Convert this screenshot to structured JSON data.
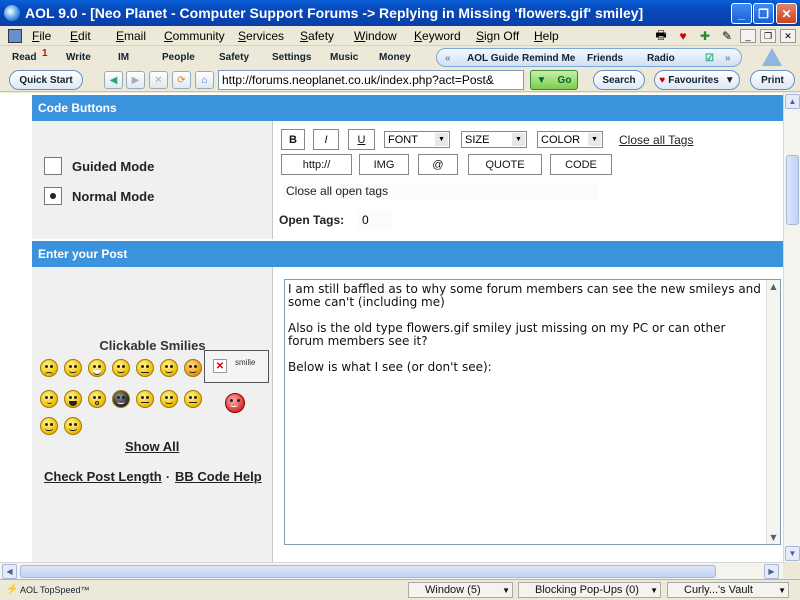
{
  "window": {
    "title": "AOL 9.0 - [Neo Planet - Computer Support Forums -> Replying in Missing 'flowers.gif' smiley]"
  },
  "menu": [
    "File",
    "Edit",
    "Email",
    "Community",
    "Services",
    "Safety",
    "Window",
    "Keyword",
    "Sign Off",
    "Help"
  ],
  "aol_toolbar": {
    "read": "Read",
    "read_badge": "1",
    "write": "Write",
    "im": "IM",
    "people": "People",
    "safety": "Safety",
    "settings": "Settings",
    "music": "Music",
    "money": "Money",
    "aol_guide": "AOL Guide",
    "remind_me": "Remind Me",
    "friends": "Friends",
    "radio": "Radio"
  },
  "nav": {
    "quick_start": "Quick Start",
    "address": "http://forums.neoplanet.co.uk/index.php?act=Post&",
    "go": "Go",
    "search": "Search",
    "favourites": "Favourites",
    "print": "Print"
  },
  "code_buttons": {
    "header": "Code Buttons",
    "guided_mode": "Guided Mode",
    "normal_mode": "Normal Mode",
    "bold": "B",
    "italic": "I",
    "underline": "U",
    "font": "FONT",
    "size": "SIZE",
    "color": "COLOR",
    "close_all_tags": "Close all Tags",
    "http": "http://",
    "img": "IMG",
    "at": "@",
    "quote": "QUOTE",
    "code": "CODE",
    "help_text": "Close all open tags",
    "open_tags_label": "Open Tags:",
    "open_tags_value": "0"
  },
  "post": {
    "header": "Enter your Post",
    "clickable_smilies": "Clickable Smilies",
    "broken_image_alt": "smilie",
    "show_all": "Show All",
    "check_length": "Check Post Length",
    "separator": "·",
    "bb_help": "BB Code Help",
    "body": [
      "I am still baffled as to why some forum members can see the new smileys and some can't (including me)",
      "Also is the old type flowers.gif smiley just missing on my PC or can other forum members see it?",
      "Below is what I see (or don't see):"
    ]
  },
  "status": {
    "topspeed": "AOL TopSpeed™",
    "window": "Window (5)",
    "popups": "Blocking Pop-Ups (0)",
    "vault": "Curly...'s Vault"
  },
  "colors": {
    "section_header": "#3a93dc",
    "title_bar": "#0a5fd8"
  }
}
